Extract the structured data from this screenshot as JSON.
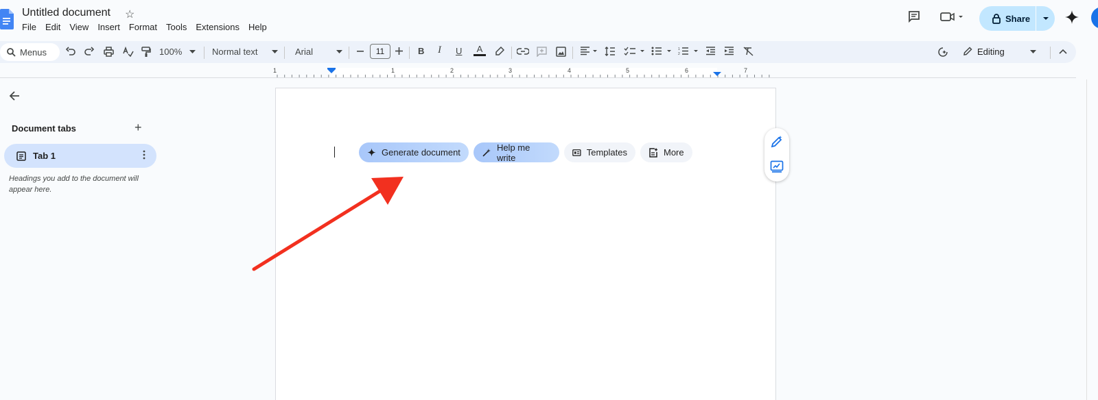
{
  "header": {
    "doc_title": "Untitled document",
    "menus": [
      "File",
      "Edit",
      "View",
      "Insert",
      "Format",
      "Tools",
      "Extensions",
      "Help"
    ],
    "share_label": "Share"
  },
  "toolbar": {
    "search_label": "Menus",
    "zoom": "100%",
    "style": "Normal text",
    "font": "Arial",
    "font_size": "11",
    "mode": "Editing"
  },
  "ruler": {
    "labels": [
      "1",
      "1",
      "2",
      "3",
      "4",
      "5",
      "6",
      "7"
    ]
  },
  "sidebar": {
    "title": "Document tabs",
    "tab_label": "Tab 1",
    "hint": "Headings you add to the document will appear here."
  },
  "chips": {
    "generate": "Generate document",
    "help_write": "Help me write",
    "templates": "Templates",
    "more": "More"
  },
  "colors": {
    "accent_blue": "#1a73e8",
    "share_bg": "#c2e7ff",
    "tab_selected_bg": "#d3e3fd",
    "annotation_arrow": "#f2301f"
  }
}
